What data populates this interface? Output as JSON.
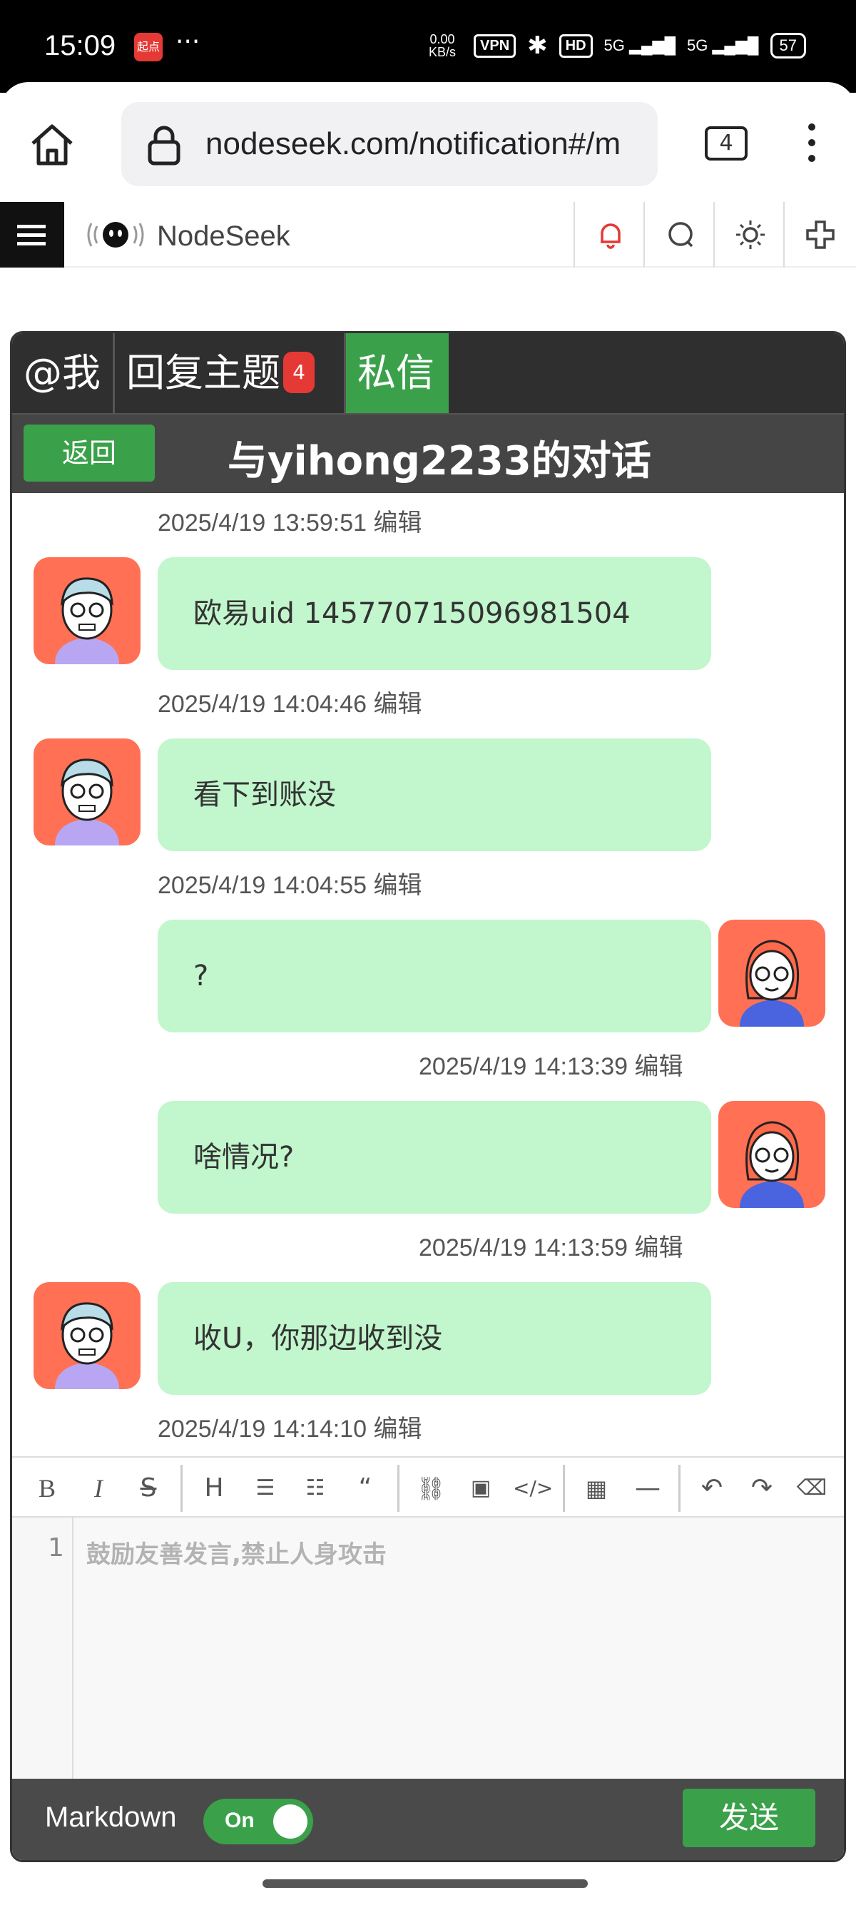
{
  "status_bar": {
    "time": "15:09",
    "app_badge": "起点",
    "more": "···",
    "net_speed": "0.00 KB/s",
    "vpn": "VPN",
    "hd": "HD",
    "signal1": "5G",
    "signal2": "5G",
    "battery": "57"
  },
  "browser": {
    "url": "nodeseek.com/notification#/m",
    "tab_count": "4"
  },
  "site": {
    "brand": "NodeSeek",
    "accent": "#3aa14a",
    "bell_color": "#e53935"
  },
  "tabs": [
    {
      "label": "@我"
    },
    {
      "label": "回复主题",
      "badge": "4"
    },
    {
      "label": "私信"
    }
  ],
  "conversation": {
    "back_label": "返回",
    "title": "与yihong2233的对话"
  },
  "messages": [
    {
      "timestamp": "2025/4/19 13:59:51 编辑",
      "text": "欧易uid 145770715096981504",
      "side": "left"
    },
    {
      "timestamp": "2025/4/19 14:04:46 编辑",
      "text": "看下到账没",
      "side": "left"
    },
    {
      "timestamp": "2025/4/19 14:04:55 编辑",
      "text": "?",
      "side": "right"
    },
    {
      "timestamp": "2025/4/19 14:13:39 编辑",
      "text": "啥情况?",
      "side": "right"
    },
    {
      "timestamp": "2025/4/19 14:13:59 编辑",
      "text": "收U，你那边收到没",
      "side": "left"
    },
    {
      "timestamp": "2025/4/19 14:14:10 编辑"
    }
  ],
  "editor": {
    "toolbar": [
      "bold-icon",
      "italic-icon",
      "strikethrough-icon",
      "heading-icon",
      "bullet-list-icon",
      "numbered-list-icon",
      "quote-icon",
      "link-icon",
      "image-icon",
      "code-icon",
      "table-icon",
      "horizontal-rule-icon",
      "undo-icon",
      "redo-icon",
      "eraser-icon"
    ],
    "line_number": "1",
    "placeholder": "鼓励友善发言,禁止人身攻击"
  },
  "footer": {
    "markdown_label": "Markdown",
    "toggle_label": "On",
    "send_label": "发送"
  }
}
